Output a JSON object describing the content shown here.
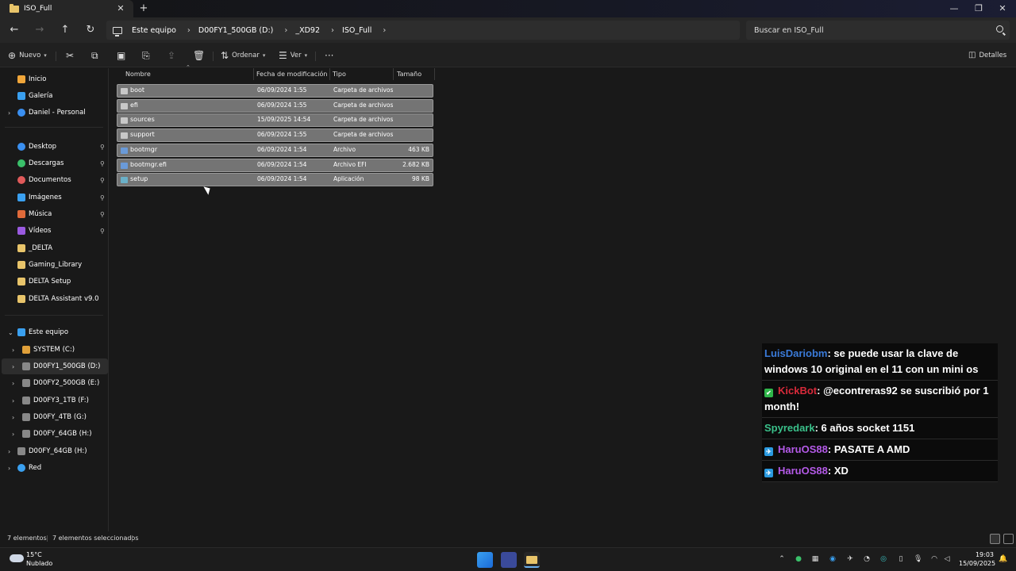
{
  "window": {
    "tab_title": "ISO_Full",
    "tab_close": "✕",
    "new_tab": "+",
    "minimize": "—",
    "maximize": "❐",
    "close": "✕"
  },
  "address_bar": {
    "crumbs": [
      "Este equipo",
      "D00FY1_500GB (D:)",
      "_XD92",
      "ISO_Full"
    ],
    "separator": "›",
    "search_placeholder": "Buscar en ISO_Full"
  },
  "toolbar": {
    "new_label": "Nuevo",
    "sort_label": "Ordenar",
    "view_label": "Ver",
    "more_label": "···",
    "details_label": "Detalles"
  },
  "sidebar": {
    "items": [
      {
        "label": "Inicio",
        "icon": "home-icon",
        "color": "#f0a63a"
      },
      {
        "label": "Galería",
        "icon": "gallery-icon",
        "color": "#3aa0f0"
      },
      {
        "label": "Daniel - Personal",
        "icon": "cloud-icon",
        "color": "#3a8ff0"
      },
      {
        "label": "Desktop",
        "icon": "desktop-icon",
        "color": "#3a8ff0"
      },
      {
        "label": "Descargas",
        "icon": "download-icon",
        "color": "#3ac06a"
      },
      {
        "label": "Documentos",
        "icon": "documents-icon",
        "color": "#e05a5a"
      },
      {
        "label": "Imágenes",
        "icon": "pictures-icon",
        "color": "#3aa0f0"
      },
      {
        "label": "Música",
        "icon": "music-icon",
        "color": "#e06a3a"
      },
      {
        "label": "Vídeos",
        "icon": "videos-icon",
        "color": "#9a5ae0"
      },
      {
        "label": "_DELTA",
        "icon": "folder-icon",
        "color": "#e8c46a"
      },
      {
        "label": "Gaming_Library",
        "icon": "folder-icon",
        "color": "#e8c46a"
      },
      {
        "label": "DELTA Setup",
        "icon": "folder-icon",
        "color": "#e8c46a"
      },
      {
        "label": "DELTA Assistant v9.0",
        "icon": "folder-icon",
        "color": "#e8c46a"
      },
      {
        "label": "Este equipo",
        "icon": "computer-icon",
        "color": "#3aa0f0"
      },
      {
        "label": "SYSTEM (C:)",
        "icon": "drive-icon",
        "color": "#e0a03a"
      },
      {
        "label": "D00FY1_500GB (D:)",
        "icon": "drive-icon",
        "color": "#888888"
      },
      {
        "label": "D00FY2_500GB (E:)",
        "icon": "drive-icon",
        "color": "#888888"
      },
      {
        "label": "D00FY3_1TB (F:)",
        "icon": "drive-icon",
        "color": "#888888"
      },
      {
        "label": "D00FY_4TB (G:)",
        "icon": "drive-icon",
        "color": "#888888"
      },
      {
        "label": "D00FY_64GB (H:)",
        "icon": "drive-icon",
        "color": "#888888"
      },
      {
        "label": "D00FY_64GB (H:)",
        "icon": "drive-icon",
        "color": "#888888"
      },
      {
        "label": "Red",
        "icon": "network-icon",
        "color": "#3aa0f0"
      }
    ]
  },
  "file_list": {
    "columns": [
      "Nombre",
      "Fecha de modificación",
      "Tipo",
      "Tamaño"
    ],
    "rows": [
      {
        "name": "boot",
        "date": "06/09/2024 1:55",
        "type": "Carpeta de archivos",
        "size": "",
        "icon": "folder-icon"
      },
      {
        "name": "efi",
        "date": "06/09/2024 1:55",
        "type": "Carpeta de archivos",
        "size": "",
        "icon": "folder-icon"
      },
      {
        "name": "sources",
        "date": "15/09/2025 14:54",
        "type": "Carpeta de archivos",
        "size": "",
        "icon": "folder-icon"
      },
      {
        "name": "support",
        "date": "06/09/2024 1:55",
        "type": "Carpeta de archivos",
        "size": "",
        "icon": "folder-icon"
      },
      {
        "name": "bootmgr",
        "date": "06/09/2024 1:54",
        "type": "Archivo",
        "size": "463 KB",
        "icon": "file-icon"
      },
      {
        "name": "bootmgr.efi",
        "date": "06/09/2024 1:54",
        "type": "Archivo EFI",
        "size": "2.682 KB",
        "icon": "file-icon"
      },
      {
        "name": "setup",
        "date": "06/09/2024 1:54",
        "type": "Aplicación",
        "size": "98 KB",
        "icon": "setup-icon"
      }
    ]
  },
  "chat": {
    "messages": [
      {
        "user": "LuisDariobm",
        "user_color": "#3a7ad8",
        "text": ": se puede usar la clave de windows 10 original en el 11 con un mini os",
        "badge": ""
      },
      {
        "user": "KickBot",
        "user_color": "#d82a3a",
        "text": ": @econtreras92 se suscribió por 1 month!",
        "badge": "✔",
        "badge_color": "#2fb64a"
      },
      {
        "user": "Spyredark",
        "user_color": "#3ac08a",
        "text": ": 6 años socket 1151",
        "badge": ""
      },
      {
        "user": "HaruOS88",
        "user_color": "#b45ae8",
        "text": ": PASATE A AMD",
        "badge": "✈",
        "badge_color": "#2a9ae0"
      },
      {
        "user": "HaruOS88",
        "user_color": "#b45ae8",
        "text": ": XD",
        "badge": "✈",
        "badge_color": "#2a9ae0"
      }
    ]
  },
  "status": {
    "count": "7 elementos",
    "selected": "7 elementos seleccionados"
  },
  "taskbar": {
    "temperature": "15°C",
    "weather": "Nublado",
    "time": "19:03",
    "date": "15/09/2025"
  }
}
